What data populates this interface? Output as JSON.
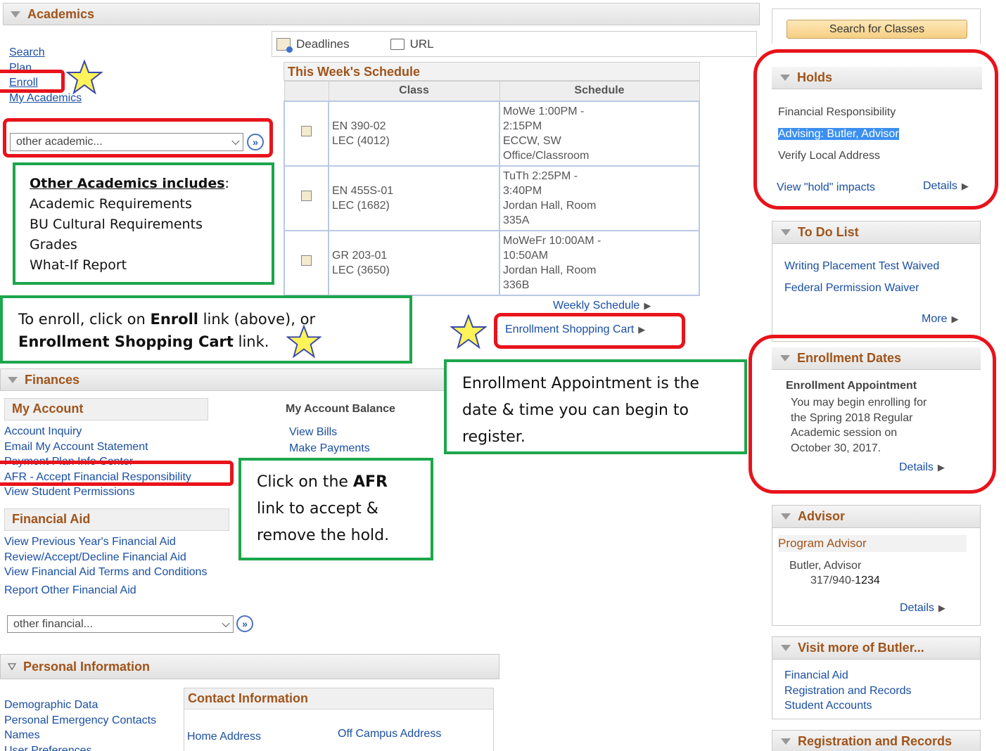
{
  "academics": {
    "title": "Academics",
    "links": [
      "Search",
      "Plan",
      "Enroll",
      "My Academics"
    ],
    "dropdown": "other academic...",
    "go": "»",
    "tabs": [
      "Deadlines",
      "URL"
    ],
    "schedule": {
      "title": "This Week's Schedule",
      "headers": [
        "Class",
        "Schedule"
      ],
      "rows": [
        {
          "class1": "EN 390-02",
          "class2": "LEC (4012)",
          "s1": "MoWe 1:00PM -",
          "s2": "2:15PM",
          "s3": "ECCW, SW",
          "s4": "Office/Classroom"
        },
        {
          "class1": "EN 455S-01",
          "class2": "LEC (1682)",
          "s1": "TuTh 2:25PM -",
          "s2": "3:40PM",
          "s3": "Jordan Hall, Room",
          "s4": "335A"
        },
        {
          "class1": "GR 203-01",
          "class2": "LEC (3650)",
          "s1": "MoWeFr 10:00AM -",
          "s2": "10:50AM",
          "s3": "Jordan Hall, Room",
          "s4": "336B"
        }
      ],
      "weekly_link": "Weekly Schedule",
      "cart_link": "Enrollment Shopping Cart"
    }
  },
  "callouts": {
    "other_academics_title": "Other Academics includes",
    "other_academics_colon": ":",
    "other_academics_items": [
      "Academic Requirements",
      "BU Cultural Requirements",
      "Grades",
      "What-If Report"
    ],
    "enroll_a": "To enroll, click on ",
    "enroll_b": "Enroll",
    "enroll_c": " link (above), or",
    "enroll_d": "Enrollment Shopping Cart",
    "enroll_e": " link.",
    "appointment": "Enrollment Appointment is the date & time you can begin to register.",
    "afr_a": "Click on the ",
    "afr_b": "AFR",
    "afr_c": " link to accept & remove the hold."
  },
  "finances": {
    "title": "Finances",
    "my_account": "My Account",
    "my_account_links": [
      "Account Inquiry",
      "Email My Account Statement",
      "Payment Plan Info Center",
      "AFR - Accept Financial Responsibility",
      "View Student Permissions"
    ],
    "balance_title": "My Account Balance",
    "balance_links": [
      "View Bills",
      "Make Payments"
    ],
    "financial_aid": "Financial Aid",
    "aid_links": [
      "View Previous Year's Financial Aid",
      "Review/Accept/Decline Financial Aid",
      "View Financial Aid Terms and Conditions"
    ],
    "report_link": "Report Other Financial Aid",
    "dropdown": "other financial..."
  },
  "personal": {
    "title": "Personal Information",
    "links": [
      "Demographic Data",
      "Personal Emergency Contacts",
      "Names",
      "User Preferences"
    ],
    "contact_title": "Contact Information",
    "home_address": "Home Address",
    "off_campus": "Off Campus Address"
  },
  "sidebar": {
    "search_button": "Search for Classes",
    "holds": {
      "title": "Holds",
      "items": [
        "Financial Responsibility",
        "Advising: Butler, Advisor",
        "Verify Local Address"
      ],
      "impacts": "View \"hold\" impacts",
      "details": "Details"
    },
    "todo": {
      "title": "To Do List",
      "items": [
        "Writing Placement Test Waived",
        "Federal Permission Waiver"
      ],
      "more": "More"
    },
    "enrollment_dates": {
      "title": "Enrollment Dates",
      "label": "Enrollment Appointment",
      "lines": [
        "You may begin enrolling for",
        "the Spring 2018 Regular",
        "Academic session on",
        "October 30, 2017."
      ],
      "details": "Details"
    },
    "advisor": {
      "title": "Advisor",
      "program": "Program Advisor",
      "name": "Butler, Advisor",
      "phone_a": "317/940-",
      "phone_b": "1234",
      "details": "Details"
    },
    "visit": {
      "title": "Visit more of Butler...",
      "links": [
        "Financial Aid",
        "Registration and Records",
        "Student Accounts"
      ]
    },
    "registration": {
      "title": "Registration and Records"
    }
  },
  "colors": {
    "accent": "#a0541a",
    "link": "#1a4fa3",
    "red": "#e8131b",
    "green": "#1ca64c",
    "star": "#fff35a"
  }
}
